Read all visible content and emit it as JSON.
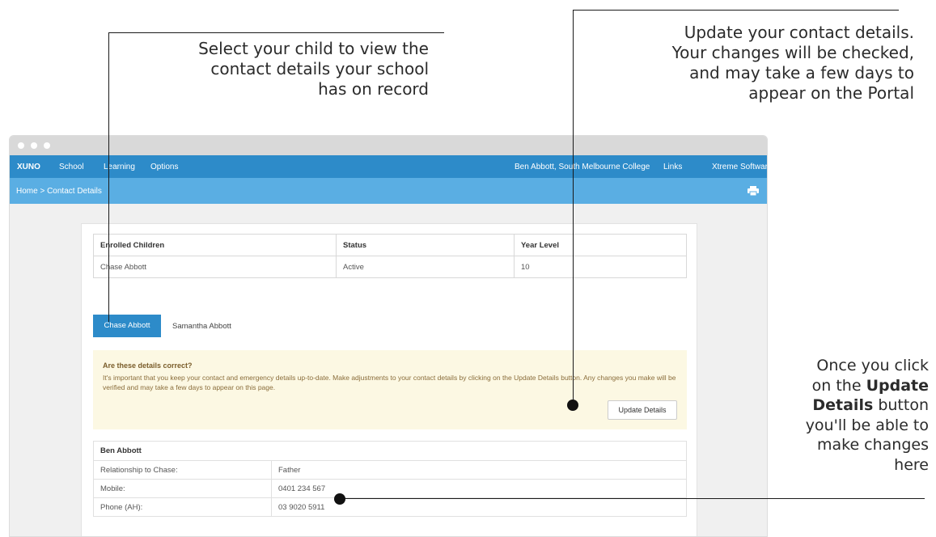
{
  "annotations": {
    "select_child": [
      "Select your child to view the",
      "contact details your school",
      "has on record"
    ],
    "update_contact": [
      "Update your contact details.",
      "Your changes will be checked,",
      "and may take a few days to",
      "appear on the Portal"
    ],
    "once_you_click": {
      "line1": "Once you click",
      "line2a": "on the ",
      "line2b": "Update",
      "line3a": "Details",
      "line3b": " button",
      "line4": "you'll be able to",
      "line5": "make changes",
      "line6": "here"
    }
  },
  "navbar": {
    "logo": "XUNO",
    "items": [
      "School",
      "Learning",
      "Options"
    ],
    "user": "Ben Abbott, South Melbourne College",
    "links": "Links",
    "vendor": "Xtreme Software",
    "color": "#2d8bc9"
  },
  "breadcrumb": {
    "text": "Home  >  Contact Details"
  },
  "enrolled": {
    "headers": [
      "Enrolled Children",
      "Status",
      "Year Level"
    ],
    "rows": [
      [
        "Chase Abbott",
        "Active",
        "10"
      ]
    ]
  },
  "child_tabs": {
    "active": "Chase Abbott",
    "other": "Samantha Abbott"
  },
  "alert": {
    "title": "Are these details correct?",
    "text": "It's important that you keep your contact and emergency details up-to-date. Make adjustments to your contact details by clicking on the Update Details button. Any changes you make will be verified and may take a few days to appear on this page.",
    "button": "Update Details",
    "background": "#fcf8e3"
  },
  "contact": {
    "name": "Ben Abbott",
    "rows": [
      {
        "label": "Relationship to Chase:",
        "value": "Father"
      },
      {
        "label": "Mobile:",
        "value": "0401 234 567"
      },
      {
        "label": "Phone (AH):",
        "value": "03 9020 5911"
      }
    ]
  }
}
